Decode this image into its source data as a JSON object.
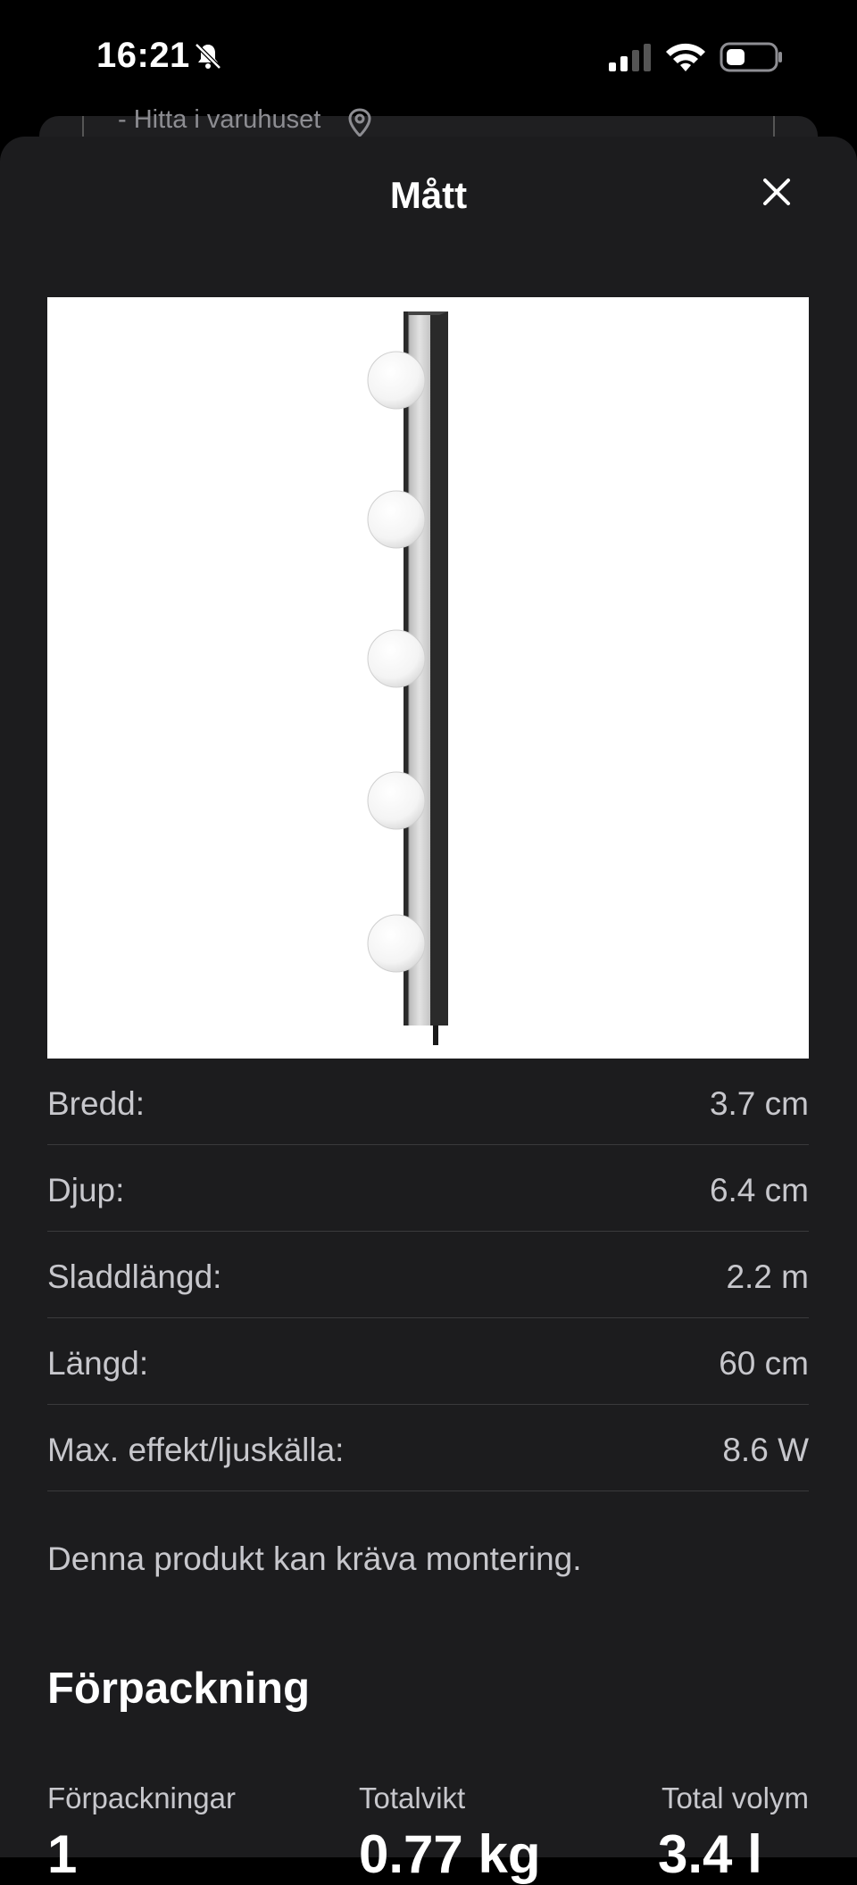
{
  "status_bar": {
    "time": "16:21",
    "icons": [
      "bell-slash-icon",
      "cellular-signal-icon",
      "wifi-icon",
      "battery-icon"
    ]
  },
  "background_page": {
    "store_link_text": "- Hitta i varuhuset",
    "store_link_icon": "location-pin-icon"
  },
  "sheet": {
    "title": "Mått",
    "close_icon": "close-icon",
    "image_alt": "Vägglampa med fem glödlampor"
  },
  "dimensions": [
    {
      "label": "Bredd:",
      "value": "3.7 cm"
    },
    {
      "label": "Djup:",
      "value": "6.4 cm"
    },
    {
      "label": "Sladdlängd:",
      "value": "2.2 m"
    },
    {
      "label": "Längd:",
      "value": "60 cm"
    },
    {
      "label": "Max. effekt/ljuskälla:",
      "value": "8.6 W"
    }
  ],
  "assembly_note": "Denna produkt kan kräva montering.",
  "packaging": {
    "heading": "Förpackning",
    "columns": [
      {
        "label": "Förpackningar",
        "value": "1"
      },
      {
        "label": "Totalvikt",
        "value": "0.77 kg"
      },
      {
        "label": "Total volym",
        "value": "3.4 l"
      }
    ]
  },
  "colors": {
    "background": "#000000",
    "sheet": "#1c1c1e",
    "text_primary": "#ffffff",
    "text_secondary": "#c7c7cc",
    "divider": "#3a3a3c"
  }
}
